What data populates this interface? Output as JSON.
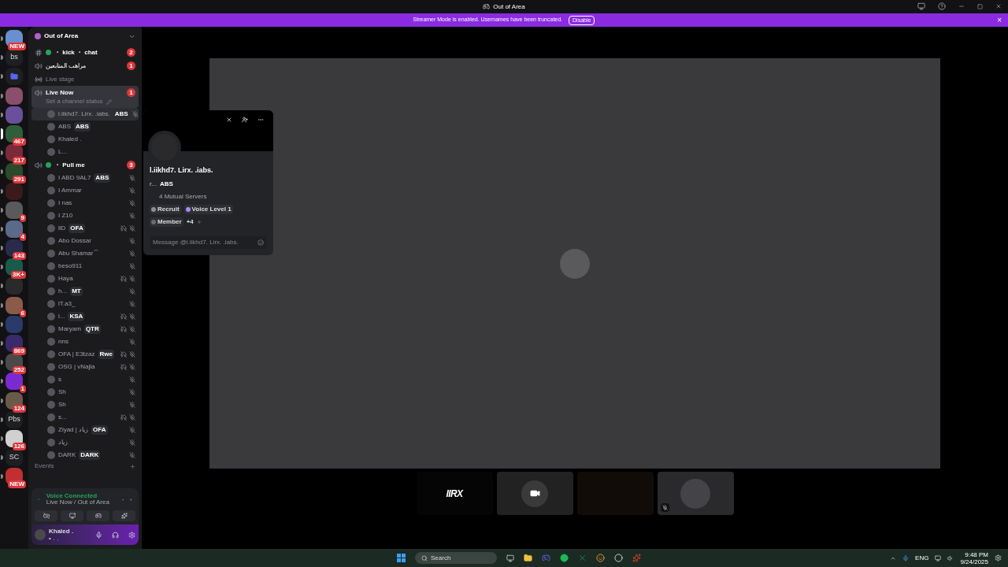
{
  "window": {
    "title": "Out of Area"
  },
  "banner": {
    "text": "Streamer Mode is enabled. Usernames have been truncated.",
    "button": "Disable",
    "close": "×"
  },
  "servers": [
    {
      "kind": "image",
      "badge": "NEW",
      "color": "#6a8fd0",
      "selected": false
    },
    {
      "kind": "text",
      "label": "bs",
      "selected": false
    },
    {
      "kind": "folder",
      "selected": false
    },
    {
      "kind": "image",
      "color": "#8a4f6a",
      "selected": false
    },
    {
      "kind": "image",
      "color": "#6a4f9a",
      "selected": false
    },
    {
      "kind": "image",
      "badge": "467",
      "color": "#2f5f3a",
      "selected": true
    },
    {
      "kind": "image",
      "badge": "217",
      "color": "#7a2a3a",
      "selected": false
    },
    {
      "kind": "image",
      "badge": "291",
      "color": "#2a4a2a",
      "selected": false
    },
    {
      "kind": "image",
      "color": "#3a1a1a",
      "selected": false
    },
    {
      "kind": "image",
      "badge": "9",
      "color": "#5a5a5a",
      "selected": false
    },
    {
      "kind": "image",
      "badge": "4",
      "color": "#5a6a8a",
      "selected": false
    },
    {
      "kind": "image",
      "badge": "143",
      "color": "#2a2a4a",
      "selected": false
    },
    {
      "kind": "image",
      "badge": "3K+",
      "color": "#1a5a4a",
      "selected": false
    },
    {
      "kind": "image",
      "color": "#2a2a2a",
      "selected": false
    },
    {
      "kind": "image",
      "badge": "6",
      "color": "#8a5a4a",
      "selected": false
    },
    {
      "kind": "image",
      "color": "#2a3a6a",
      "selected": false
    },
    {
      "kind": "image",
      "badge": "869",
      "color": "#3a2a6a",
      "selected": false
    },
    {
      "kind": "image",
      "badge": "252",
      "color": "#4a4a4a",
      "selected": false
    },
    {
      "kind": "image",
      "badge": "1",
      "color": "#7a2ad0",
      "selected": false
    },
    {
      "kind": "image",
      "badge": "124",
      "color": "#6a5a4a",
      "selected": false
    },
    {
      "kind": "text",
      "label": "Pbs",
      "selected": false
    },
    {
      "kind": "image",
      "badge": "126",
      "color": "#d0d0d0",
      "selected": false
    },
    {
      "kind": "text",
      "label": "SC",
      "selected": false
    },
    {
      "kind": "image",
      "badge": "NEW",
      "color": "#c03030",
      "selected": false
    }
  ],
  "server_header": {
    "name": "Out of Area"
  },
  "channels": [
    {
      "kind": "text",
      "name": "・ kick ・ chat",
      "live": true,
      "unread": "2",
      "selected": false
    },
    {
      "kind": "voice",
      "name": "مراهب المتابعين",
      "live": false,
      "unread": "1",
      "selected": false
    },
    {
      "kind": "stage",
      "name": "Live stage",
      "live": false,
      "selected": false
    },
    {
      "kind": "voice",
      "name": "Live Now",
      "live": false,
      "unread": "1",
      "status": "Set a channel status",
      "selected": true,
      "members": [
        {
          "name": "l.iikhd7. Lirx. .iabs.",
          "tag": "ABS",
          "muted": true,
          "deafened": false,
          "hovered": true
        },
        {
          "name": "ABS",
          "tag": "ABS",
          "muted": false,
          "deafened": false,
          "hovered": false
        },
        {
          "name": "Khaled .",
          "muted": false,
          "deafened": false,
          "hovered": false
        },
        {
          "name": "L...",
          "muted": false,
          "deafened": false,
          "hovered": false
        }
      ]
    },
    {
      "kind": "voice",
      "name": "・ Pull me",
      "live": true,
      "unread": "3",
      "selected": false,
      "members": [
        {
          "name": "I ABD 9AL7",
          "tag": "ABS",
          "muted": true,
          "deafened": false,
          "hovered": false
        },
        {
          "name": "I Ammar",
          "muted": true,
          "deafened": false,
          "hovered": false
        },
        {
          "name": "I nas",
          "muted": true,
          "deafened": false,
          "hovered": false
        },
        {
          "name": "I Z10",
          "muted": true,
          "deafened": false,
          "hovered": false
        },
        {
          "name": "llD",
          "tag": "OFA",
          "muted": true,
          "deafened": true,
          "hovered": false
        },
        {
          "name": "Abo Dossar",
          "muted": true,
          "deafened": false,
          "hovered": false
        },
        {
          "name": "Abu Shamar⌒",
          "muted": true,
          "deafened": false,
          "hovered": false
        },
        {
          "name": "beso911",
          "muted": true,
          "deafened": false,
          "hovered": false
        },
        {
          "name": "Haya",
          "muted": true,
          "deafened": true,
          "hovered": false
        },
        {
          "name": "h...",
          "tag": "MT",
          "muted": true,
          "deafened": false,
          "hovered": false
        },
        {
          "name": "lT.a3_",
          "muted": true,
          "deafened": false,
          "hovered": false
        },
        {
          "name": "l...",
          "tag": "KSA",
          "muted": true,
          "deafened": true,
          "hovered": false
        },
        {
          "name": "Maryam",
          "tag": "QTR",
          "muted": true,
          "deafened": true,
          "hovered": false
        },
        {
          "name": "nns",
          "muted": true,
          "deafened": false,
          "hovered": false
        },
        {
          "name": "OFA | E3tzaz",
          "tag": "Rwe",
          "muted": true,
          "deafened": true,
          "hovered": false
        },
        {
          "name": "OSG | vNajla",
          "muted": true,
          "deafened": true,
          "hovered": false
        },
        {
          "name": "s",
          "muted": true,
          "deafened": false,
          "hovered": false
        },
        {
          "name": "Sh",
          "muted": true,
          "deafened": false,
          "hovered": false
        },
        {
          "name": "Sh",
          "muted": true,
          "deafened": false,
          "hovered": false
        },
        {
          "name": "s...",
          "muted": true,
          "deafened": true,
          "hovered": false
        },
        {
          "name": "Ziyad | زياد",
          "tag": "OFA",
          "muted": true,
          "deafened": false,
          "hovered": false
        },
        {
          "name": "زياد",
          "muted": true,
          "deafened": false,
          "hovered": false
        },
        {
          "name": "DARK",
          "tag": "DARK",
          "muted": true,
          "deafened": false,
          "hovered": false
        }
      ]
    }
  ],
  "events": {
    "label": "Events"
  },
  "voice_panel": {
    "status": "Voice Connected",
    "location": "Live Now / Out of Area"
  },
  "user_panel": {
    "name": "Khaled .",
    "status": "• . ."
  },
  "profile_popup": {
    "name": "l.iikhd7. Lirx. .iabs.",
    "subtitle": "r...",
    "tag": "ABS",
    "mutual": "4 Mutual Servers",
    "roles": [
      {
        "name": "Recruit",
        "color": "#8e8e96"
      },
      {
        "name": "Voice Level 1",
        "color": "#a78bfa"
      },
      {
        "name": "Member",
        "color": "#6b6b72"
      }
    ],
    "more_roles": "+4",
    "message_placeholder": "Message @l.iikhd7. Lirx. .iabs."
  },
  "tiles": [
    {
      "kind": "logo",
      "label": "lIRX"
    },
    {
      "kind": "camera"
    },
    {
      "kind": "photo"
    },
    {
      "kind": "avatar",
      "muted": true
    }
  ],
  "taskbar": {
    "search": "Search",
    "language": "ENG",
    "time": "9:48 PM",
    "date": "9/24/2025"
  }
}
